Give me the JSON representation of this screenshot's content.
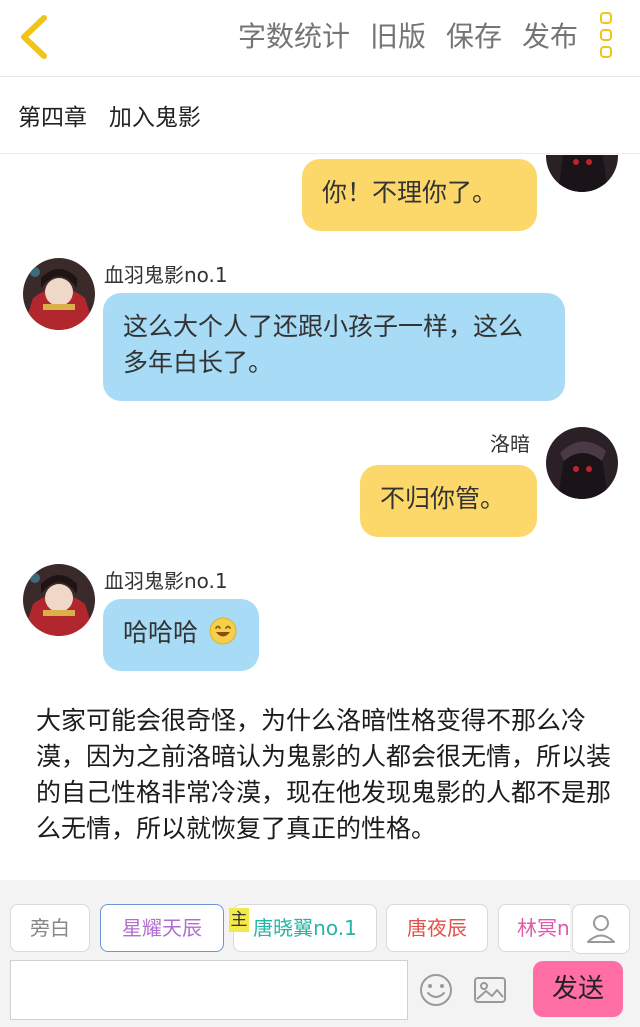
{
  "header": {
    "actions": [
      "字数统计",
      "旧版",
      "保存",
      "发布"
    ]
  },
  "chapter": {
    "title": "第四章   加入鬼影"
  },
  "feed": {
    "messages": [
      {
        "side": "right",
        "sender": "",
        "text": "你！不理你了。",
        "bubble_color": "#fcd86a"
      },
      {
        "side": "left",
        "sender": "血羽鬼影no.1",
        "text": "这么大个人了还跟小孩子一样，这么多年白长了。",
        "bubble_color": "#a7dbf6"
      },
      {
        "side": "right",
        "sender": "洛暗",
        "text": "不归你管。",
        "bubble_color": "#fcd86a"
      },
      {
        "side": "left",
        "sender": "血羽鬼影no.1",
        "text": "哈哈哈",
        "emoji": "laughing-emoji",
        "bubble_color": "#a7dbf6"
      }
    ],
    "narration": "大家可能会很奇怪，为什么洛暗性格变得不那么冷漠，因为之前洛暗认为鬼影的人都会很无情，所以装的自己性格非常冷漠，现在他发现鬼影的人都不是那么无情，所以就恢复了真正的性格。"
  },
  "rolebar": {
    "roles": [
      {
        "label": "旁白",
        "color": "#888888"
      },
      {
        "label": "星耀天辰",
        "color": "#b06fd0",
        "selected": true
      },
      {
        "label": "唐晓翼no.1",
        "color": "#26b5a5",
        "main": true
      },
      {
        "label": "唐夜辰",
        "color": "#e0524a"
      },
      {
        "label": "林冥n",
        "color": "#e05aa8"
      }
    ],
    "main_tag": "主",
    "input": {
      "value": "",
      "placeholder": ""
    },
    "send_label": "发送"
  },
  "colors": {
    "accent": "#f0c419",
    "send": "#ff6fa5",
    "bubble_self": "#fcd86a",
    "bubble_other": "#a7dbf6"
  }
}
